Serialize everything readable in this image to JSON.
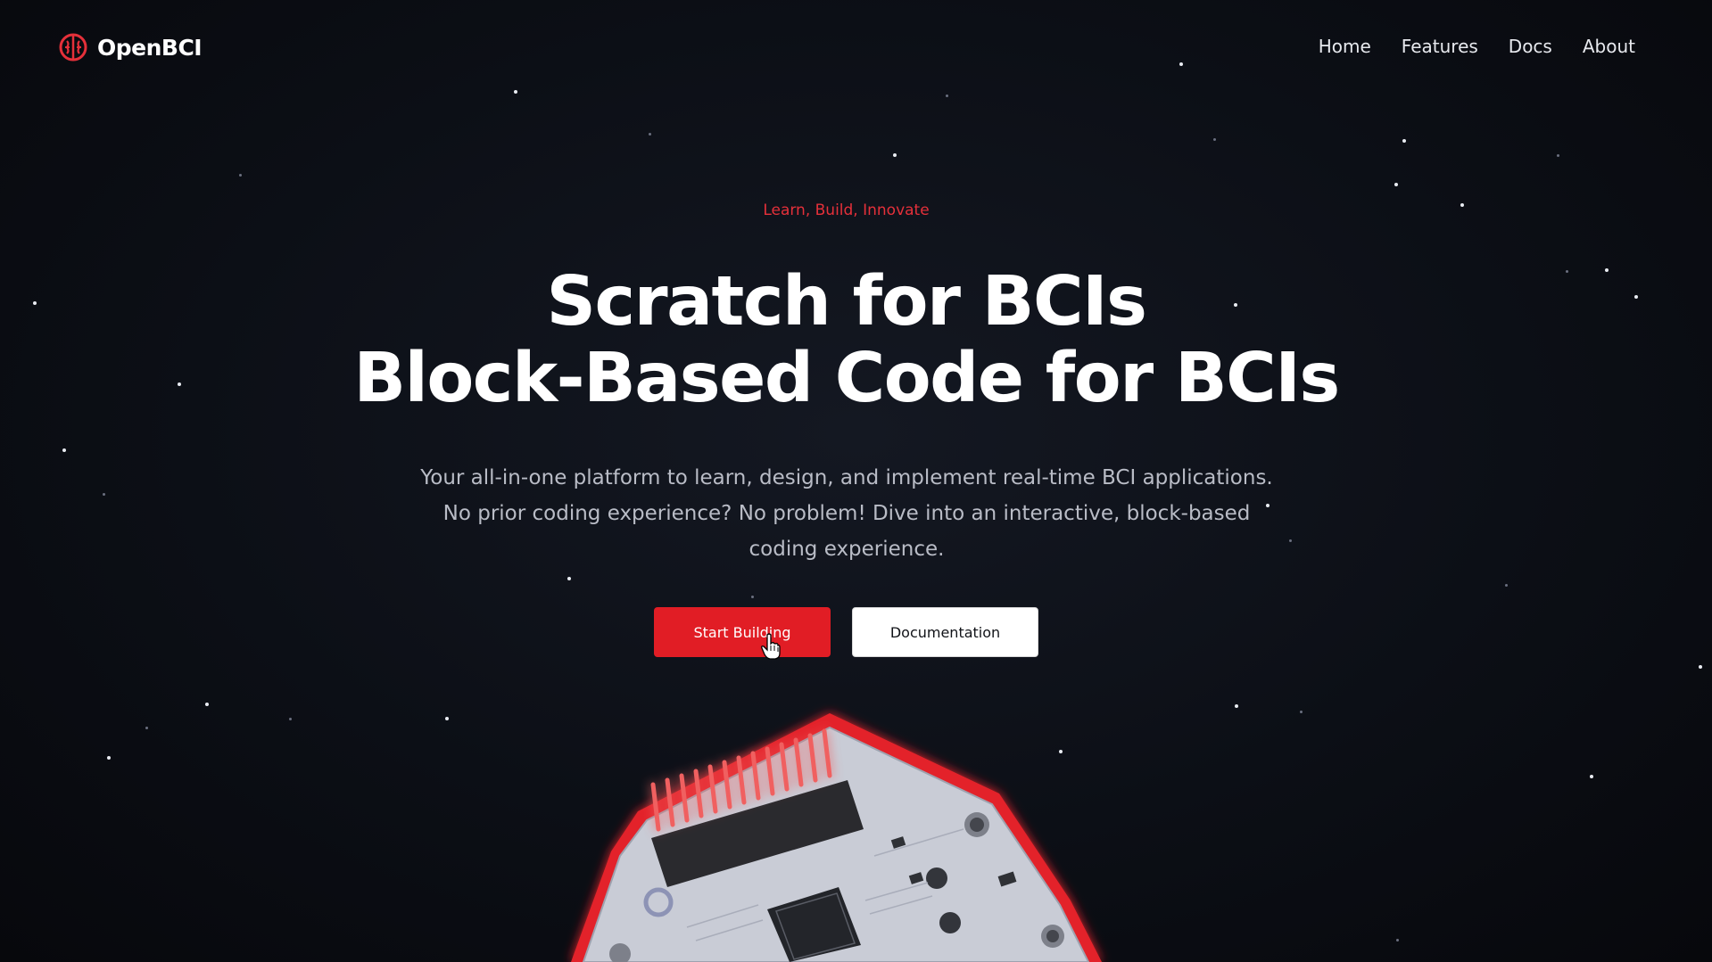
{
  "nav": {
    "brand": "OpenBCI",
    "links": [
      "Home",
      "Features",
      "Docs",
      "About"
    ]
  },
  "hero": {
    "eyebrow": "Learn, Build, Innovate",
    "title_line1": "Scratch for BCIs",
    "title_line2": "Block-Based Code for BCIs",
    "subtitle": "Your all-in-one platform to learn, design, and implement real-time BCI applications. No prior coding experience? No problem! Dive into an interactive, block-based coding experience.",
    "primary_button": "Start Building",
    "secondary_button": "Documentation"
  },
  "icons": {
    "brand": "brain-icon",
    "cursor": "hand-pointer-cursor-icon"
  },
  "colors": {
    "background": "#0b0d13",
    "accent": "#e11d25",
    "eyebrow": "#e5303a",
    "text": "#ffffff",
    "muted_text": "#b9bcc6"
  }
}
